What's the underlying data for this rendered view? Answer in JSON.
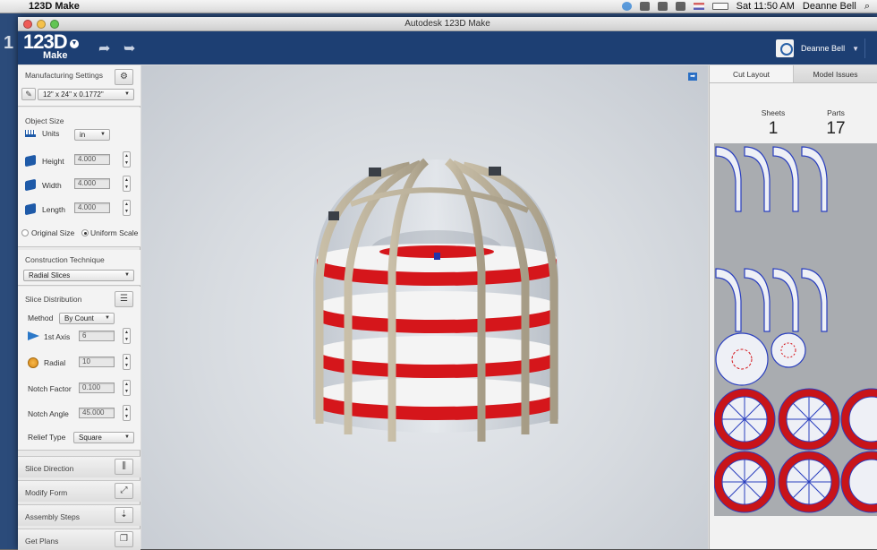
{
  "menubar": {
    "app_name": "123D Make",
    "clock": "Sat 11:50 AM",
    "user": "Deanne Bell",
    "icons": [
      "dropbox-icon",
      "wifi-icon",
      "bluetooth-icon",
      "volume-icon",
      "flag-icon",
      "battery-icon",
      "search-icon"
    ]
  },
  "window": {
    "title": "Autodesk 123D Make"
  },
  "header": {
    "logo_number": "123D",
    "logo_word": "Make",
    "user_name": "Deanne Bell"
  },
  "left": {
    "manufacturing_settings": "Manufacturing Settings",
    "material": "12\" x 24\" x 0.1772\"",
    "object_size": "Object Size",
    "units_label": "Units",
    "units_value": "in",
    "height_label": "Height",
    "height_value": "4.000",
    "width_label": "Width",
    "width_value": "4.000",
    "length_label": "Length",
    "length_value": "4.000",
    "original_size": "Original Size",
    "uniform_scale": "Uniform Scale",
    "construction_technique": "Construction Technique",
    "technique_value": "Radial Slices",
    "slice_distribution": "Slice Distribution",
    "method_label": "Method",
    "method_value": "By Count",
    "axis1_label": "1st Axis",
    "axis1_value": "6",
    "radial_label": "Radial",
    "radial_value": "10",
    "notch_factor_label": "Notch Factor",
    "notch_factor_value": "0.100",
    "notch_angle_label": "Notch Angle",
    "notch_angle_value": "45.000",
    "relief_type_label": "Relief Type",
    "relief_type_value": "Square",
    "collapsed": [
      "Slice Direction",
      "Modify Form",
      "Assembly Steps",
      "Get Plans"
    ]
  },
  "right": {
    "tab_cut_layout": "Cut Layout",
    "tab_model_issues": "Model Issues",
    "sheets_label": "Sheets",
    "sheets_value": "1",
    "parts_label": "Parts",
    "parts_value": "17"
  },
  "colors": {
    "header_blue": "#1d3f73",
    "slice_red": "#d5161b",
    "part_outline_blue": "#2a3fbf"
  }
}
